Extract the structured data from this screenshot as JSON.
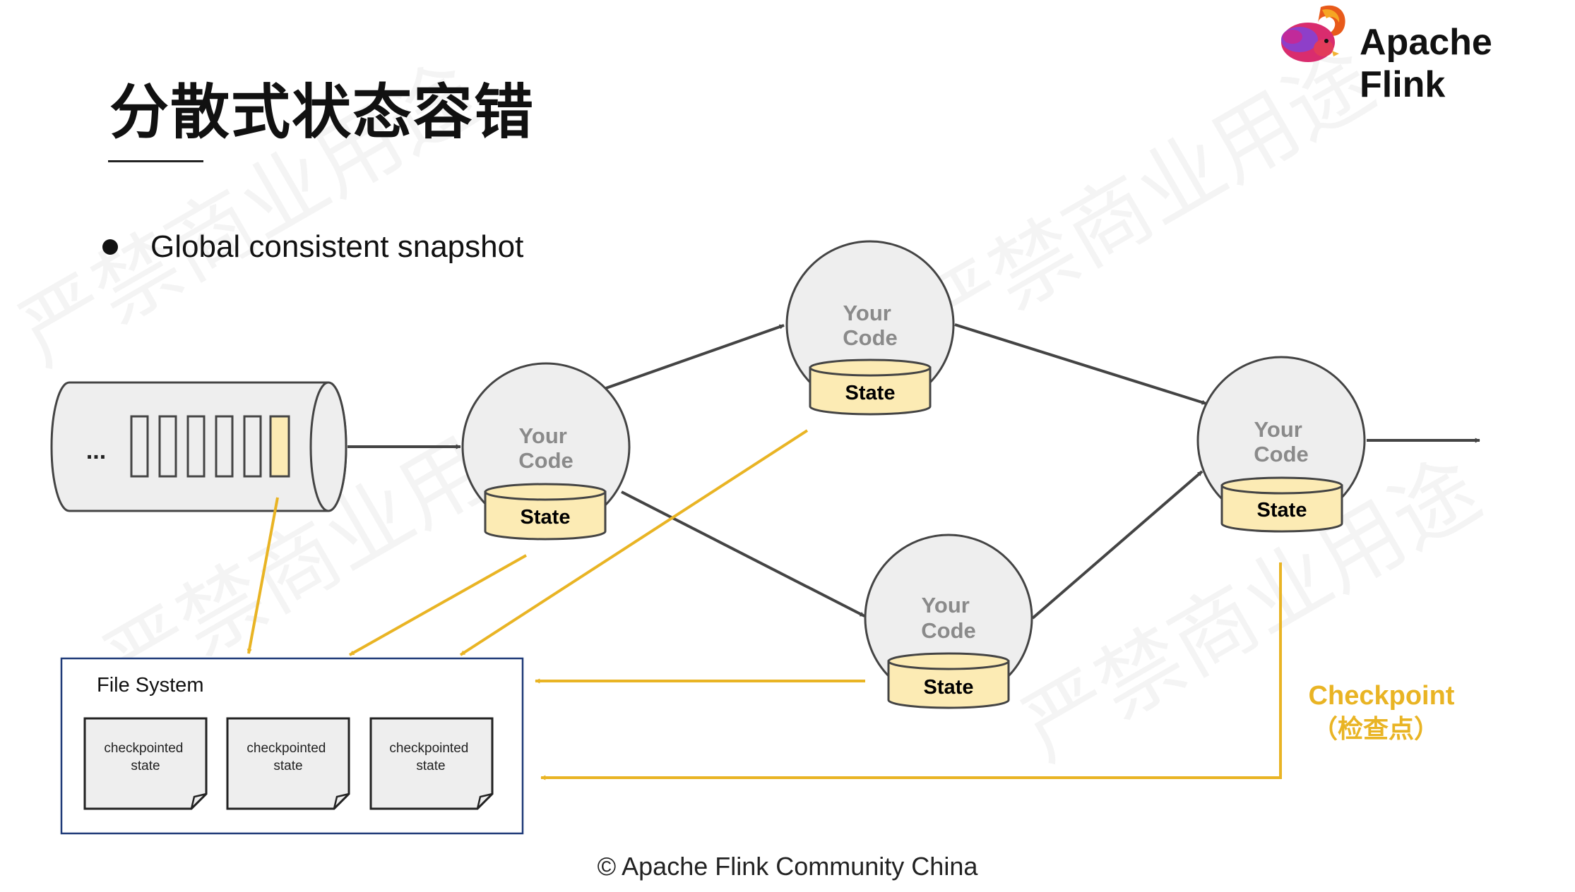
{
  "slide": {
    "title": "分散式状态容错",
    "brand_name": "Apache Flink",
    "bullet": "Global consistent snapshot",
    "footer": "© Apache Flink Community China"
  },
  "diagram": {
    "queue_ellipsis": "...",
    "nodes": [
      {
        "code_line1": "Your",
        "code_line2": "Code",
        "state": "State"
      },
      {
        "code_line1": "Your",
        "code_line2": "Code",
        "state": "State"
      },
      {
        "code_line1": "Your",
        "code_line2": "Code",
        "state": "State"
      },
      {
        "code_line1": "Your",
        "code_line2": "Code",
        "state": "State"
      }
    ],
    "file_system": {
      "label": "File System",
      "files": [
        {
          "line1": "checkpointed",
          "line2": "state"
        },
        {
          "line1": "checkpointed",
          "line2": "state"
        },
        {
          "line1": "checkpointed",
          "line2": "state"
        }
      ]
    },
    "checkpoint_label": "Checkpoint",
    "checkpoint_sublabel": "（检查点）",
    "watermark": "严禁商业用途"
  },
  "colors": {
    "checkpoint_yellow": "#E9B424",
    "state_fill": "#FCEBB4",
    "node_fill": "#EEEEEE",
    "edge_gray": "#444444",
    "file_system_border": "#1F3A78",
    "code_text_gray": "#8A8A8A"
  }
}
